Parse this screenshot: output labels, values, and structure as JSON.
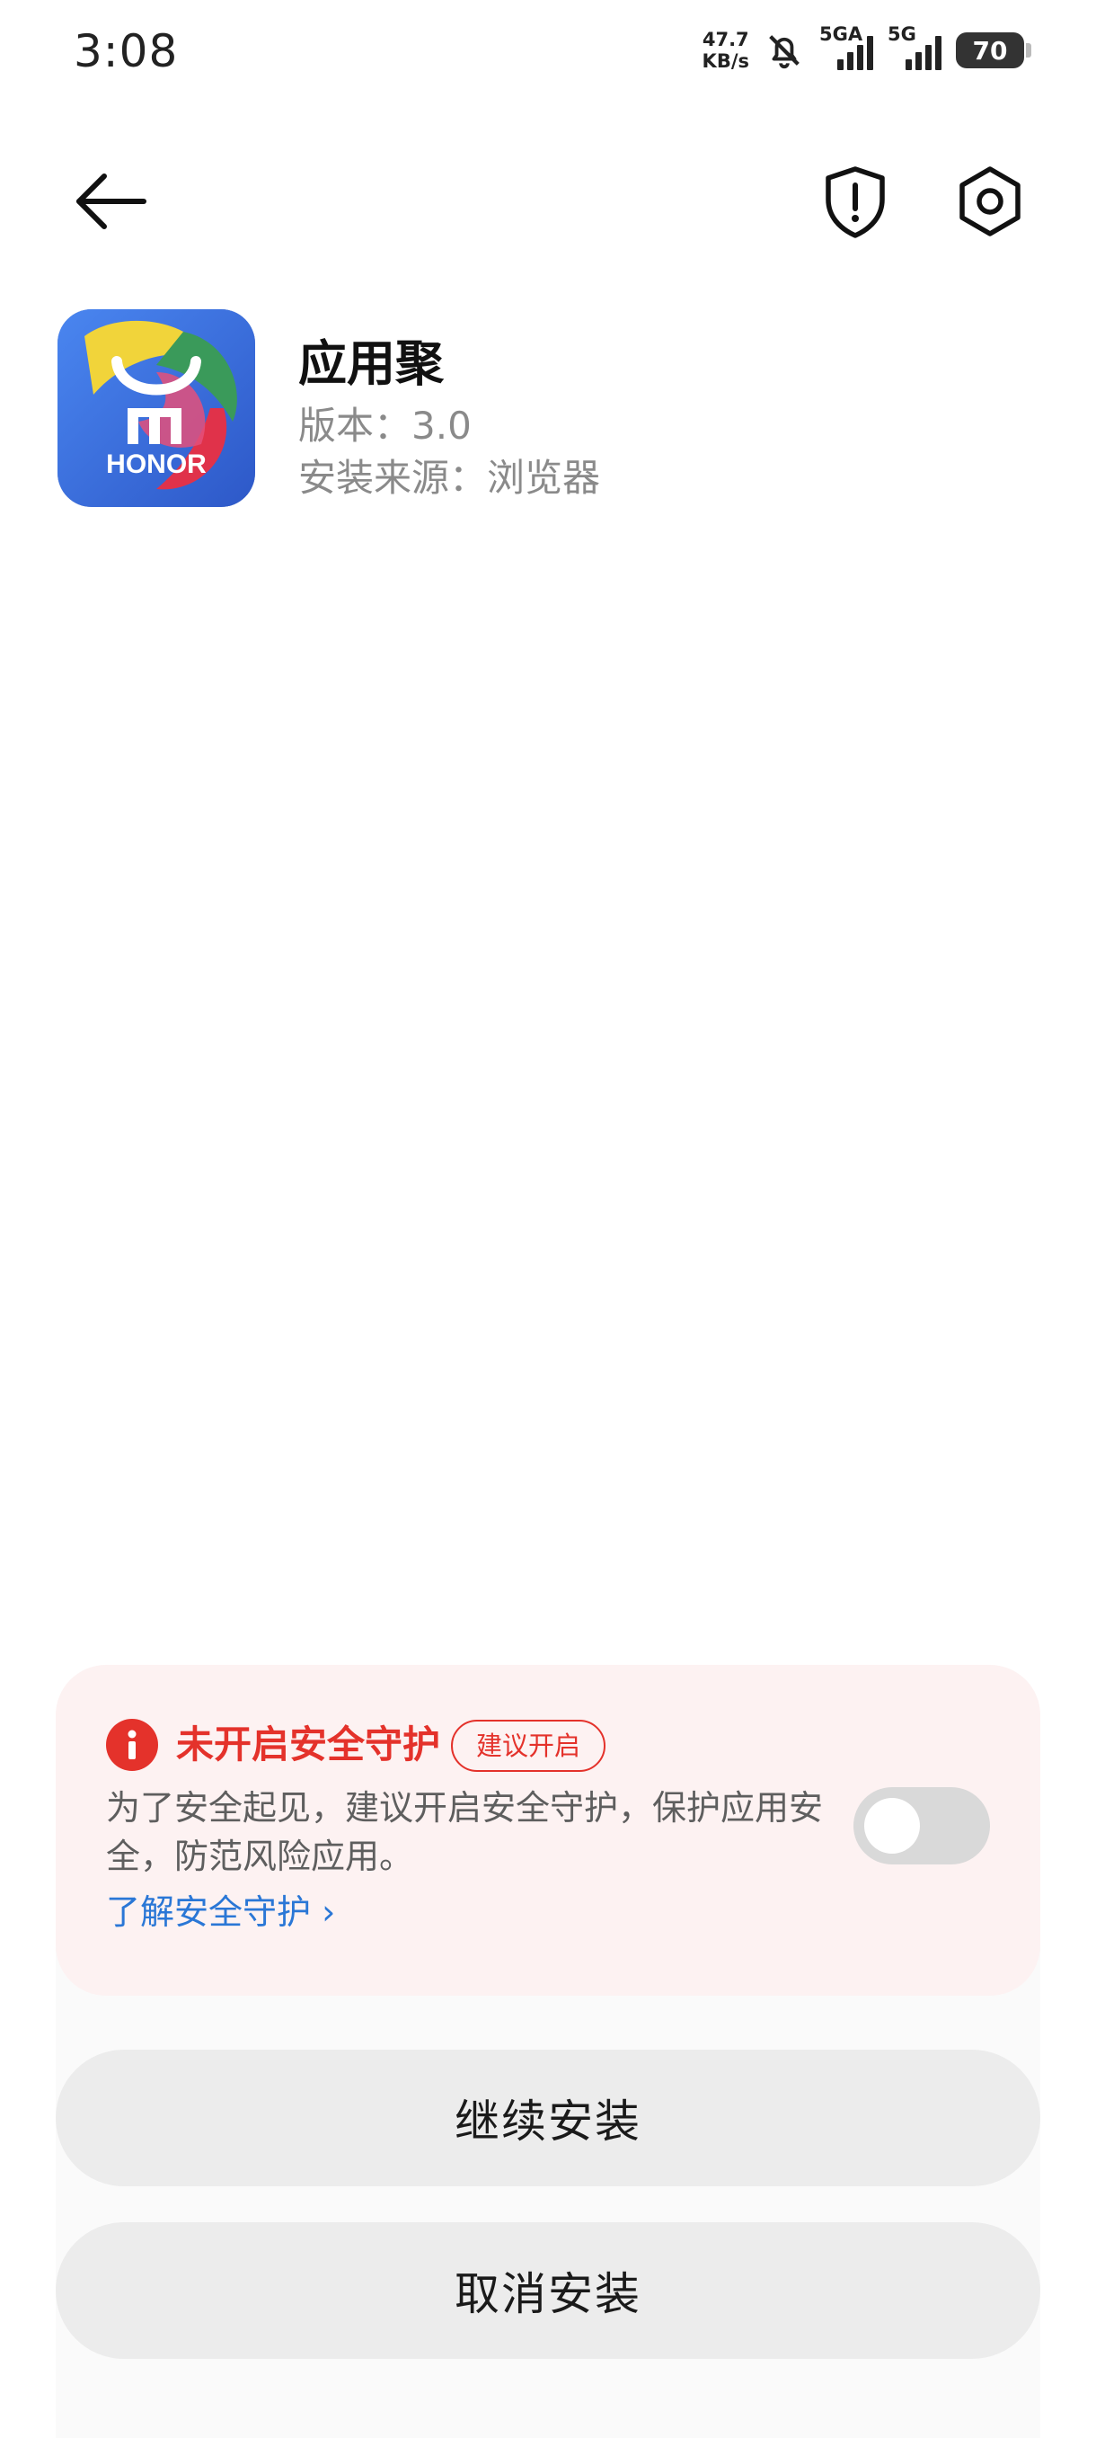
{
  "status_bar": {
    "time": "3:08",
    "net_speed_value": "47.7",
    "net_speed_unit": "KB/s",
    "sim1_label": "5GA",
    "sim2_label": "5G",
    "battery": "70",
    "icons": [
      "bell-off-icon",
      "signal-icon",
      "battery-icon"
    ]
  },
  "top_nav": {
    "back_icon": "arrow-left-icon",
    "actions": [
      "shield-alert-icon",
      "settings-gear-icon"
    ]
  },
  "app": {
    "name": "应用聚",
    "version": "版本：3.0",
    "source": "安装来源：浏览器",
    "icon_text": "HONOR"
  },
  "security": {
    "title": "未开启安全守护",
    "badge": "建议开启",
    "description": "为了安全起见，建议开启安全守护，保护应用安全，防范风险应用。",
    "link": "了解安全守护 ›",
    "toggle_on": false,
    "accent": "#e4322b",
    "link_color": "#2a77d6"
  },
  "buttons": {
    "continue": "继续安装",
    "cancel": "取消安装"
  }
}
